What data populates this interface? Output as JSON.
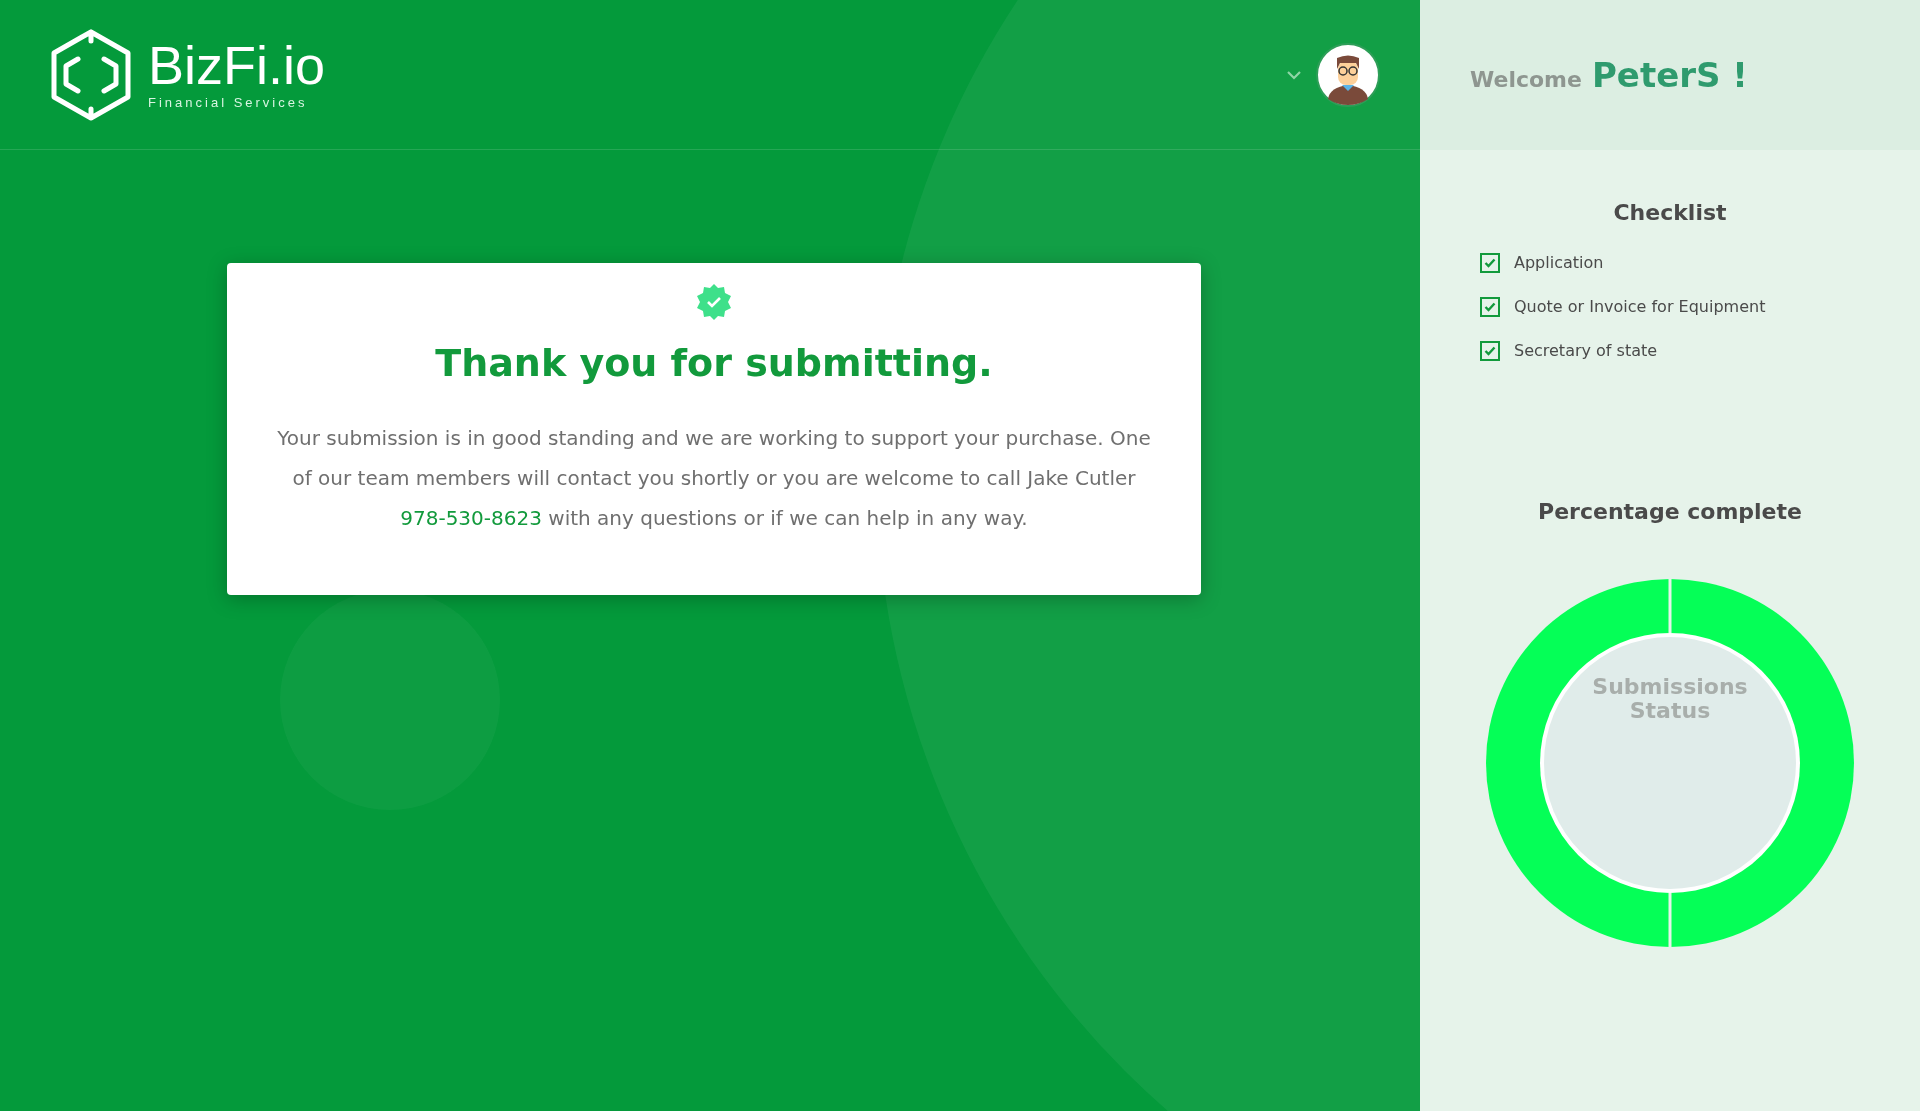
{
  "brand": {
    "name": "BizFi.io",
    "tagline": "Financial Services"
  },
  "welcome": {
    "greeting": "Welcome",
    "user": "PeterS !"
  },
  "message": {
    "title": "Thank you for submitting.",
    "text_before": "Your submission is in good standing and we are working to support your purchase. One of our team members will contact you shortly or you are welcome to call Jake Cutler",
    "phone": "978-530-8623",
    "text_after": "with any questions or if we can help in any way."
  },
  "checklist": {
    "title": "Checklist",
    "items": [
      {
        "label": "Application",
        "checked": true
      },
      {
        "label": "Quote or Invoice for Equipment",
        "checked": true
      },
      {
        "label": "Secretary of state",
        "checked": true
      }
    ]
  },
  "progress": {
    "title": "Percentage complete",
    "center_label": "Submissions Status"
  }
}
